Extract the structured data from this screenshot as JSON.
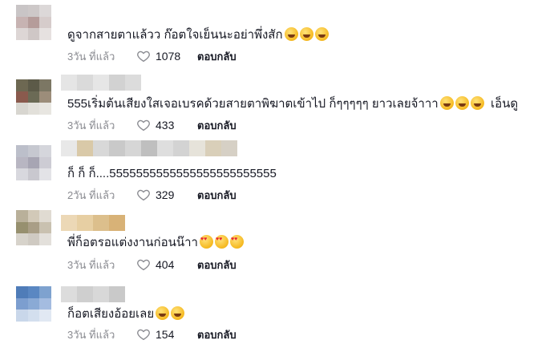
{
  "comments": [
    {
      "text": "ดูจากสายตาแล้วว ก๊อตใจเย็นนะอย่าพึ่งสัก",
      "emojis": [
        "laugh",
        "laugh",
        "laugh"
      ],
      "time": "3วัน ที่แล้ว",
      "likes": "1078",
      "reply_label": "ตอบกลับ",
      "avatar_colors": [
        "#c9c5c6",
        "#cdc8c8",
        "#dcd8d8",
        "#c7b3b2",
        "#b59c9a",
        "#d6cccb",
        "#ddd6d5",
        "#cfc7c6",
        "#e6e1e0"
      ],
      "name_colors": []
    },
    {
      "text": "555เริ่มต้นเสียงใสเจอเบรคด้วยสายตาพิฆาตเข้าไป ก็ๆๆๆๆๆ ยาวเลยจ้าาา",
      "emojis": [
        "laugh",
        "laugh",
        "laugh"
      ],
      "suffix": " เอ็นดู",
      "time": "3วัน ที่แล้ว",
      "likes": "433",
      "reply_label": "ตอบกลับ",
      "avatar_colors": [
        "#6d6852",
        "#5c5a48",
        "#7c7764",
        "#8a5a4d",
        "#6b6a55",
        "#9c8d7a",
        "#d8d6d0",
        "#e2e0da",
        "#e8e6e1"
      ],
      "name_colors": [
        "#e5e5e5",
        "#dadada",
        "#e6e6e6",
        "#d2d2d2",
        "#dcdcdc"
      ]
    },
    {
      "text": "ก็ ก็ ก็....5555555555555555555555555",
      "emojis": [],
      "time": "2วัน ที่แล้ว",
      "likes": "329",
      "reply_label": "ตอบกลับ",
      "avatar_colors": [
        "#bcbfca",
        "#c6c8d0",
        "#d5d6dc",
        "#b8b6c2",
        "#a7a5b3",
        "#cdccd4",
        "#d8d8de",
        "#c9c8cf",
        "#e3e3e7"
      ],
      "name_colors": [
        "#e8e8e8",
        "#d9c9a8",
        "#d8d8d8",
        "#c9c9c9",
        "#d6d6d6",
        "#bfbfbf",
        "#dedede",
        "#d3d3d3",
        "#e6e3da",
        "#d9cfb9",
        "#d6d0c5"
      ]
    },
    {
      "text": "พี่ก็อตรอแต่งงานก่อนน๊าา",
      "emojis": [
        "heart-eyes",
        "heart-eyes",
        "heart-eyes"
      ],
      "time": "3วัน ที่แล้ว",
      "likes": "404",
      "reply_label": "ตอบกลับ",
      "avatar_colors": [
        "#b9b09a",
        "#d2c9b8",
        "#e0dbd2",
        "#97906f",
        "#a99e86",
        "#c9c1b0",
        "#d7d3cb",
        "#cfcac2",
        "#e3e0db"
      ],
      "name_colors": [
        "#ecd8b6",
        "#e7cfa3",
        "#dcbf8c",
        "#d8b277"
      ]
    },
    {
      "text": "ก็อตเสียงอ้อยเลย",
      "emojis": [
        "laugh",
        "laugh"
      ],
      "time": "3วัน ที่แล้ว",
      "likes": "154",
      "reply_label": "ตอบกลับ",
      "avatar_colors": [
        "#4f7cb8",
        "#5a87c2",
        "#7ea2cf",
        "#7c9ecf",
        "#8aaad5",
        "#a4bce0",
        "#c9d7ea",
        "#d3dfee",
        "#e1e8f3"
      ],
      "name_colors": [
        "#dcdcdc",
        "#cfcfcf",
        "#d8d8d8",
        "#c9c9c9"
      ]
    }
  ]
}
